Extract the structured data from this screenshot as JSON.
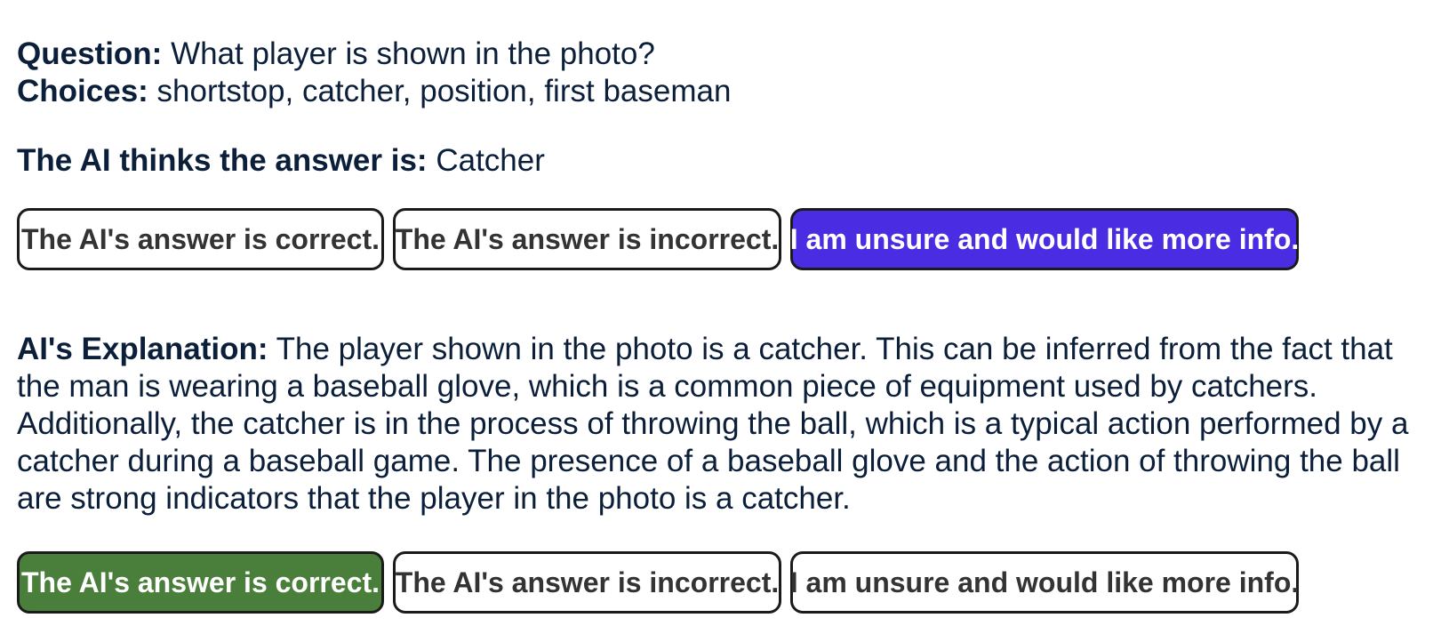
{
  "question": {
    "label": "Question:",
    "text": "What player is shown in the photo?"
  },
  "choices": {
    "label": "Choices:",
    "text": "shortstop, catcher, position, first baseman"
  },
  "ai_answer": {
    "label": "The AI thinks the answer is:",
    "text": "Catcher"
  },
  "answer_feedback": {
    "correct_label": "The AI's answer is correct.",
    "incorrect_label": "The AI's answer is incorrect.",
    "unsure_label": "I am unsure and would like more info.",
    "selected": "unsure",
    "selected_color": "#4a2de3"
  },
  "explanation": {
    "label": "AI's Explanation:",
    "text": "The player shown in the photo is a catcher. This can be inferred from the fact that the man is wearing a baseball glove, which is a common piece of equipment used by catchers. Additionally, the catcher is in the process of throwing the ball, which is a typical action performed by a catcher during a baseball game. The presence of a baseball glove and the action of throwing the ball are strong indicators that the player in the photo is a catcher."
  },
  "explanation_feedback": {
    "correct_label": "The AI's answer is correct.",
    "incorrect_label": "The AI's answer is incorrect.",
    "unsure_label": "I am unsure and would like more info.",
    "selected": "correct",
    "selected_color": "#4a7f3b"
  }
}
